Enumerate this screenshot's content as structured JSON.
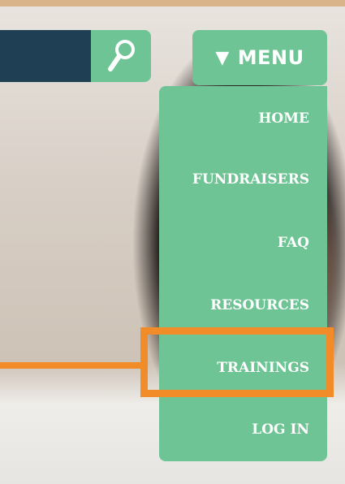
{
  "header": {
    "search_placeholder": "",
    "search_icon": "magnifier-icon",
    "menu_arrow": "▼",
    "menu_label": "MENU"
  },
  "menu": {
    "items": [
      {
        "label": "HOME"
      },
      {
        "label": "FUNDRAISERS"
      },
      {
        "label": "FAQ"
      },
      {
        "label": "RESOURCES"
      },
      {
        "label": "TRAININGS"
      },
      {
        "label": "LOG IN"
      }
    ],
    "highlighted_index": 4
  },
  "colors": {
    "accent_green": "#6ec494",
    "search_field": "#1f3f55",
    "highlight_orange": "#f28c28"
  }
}
